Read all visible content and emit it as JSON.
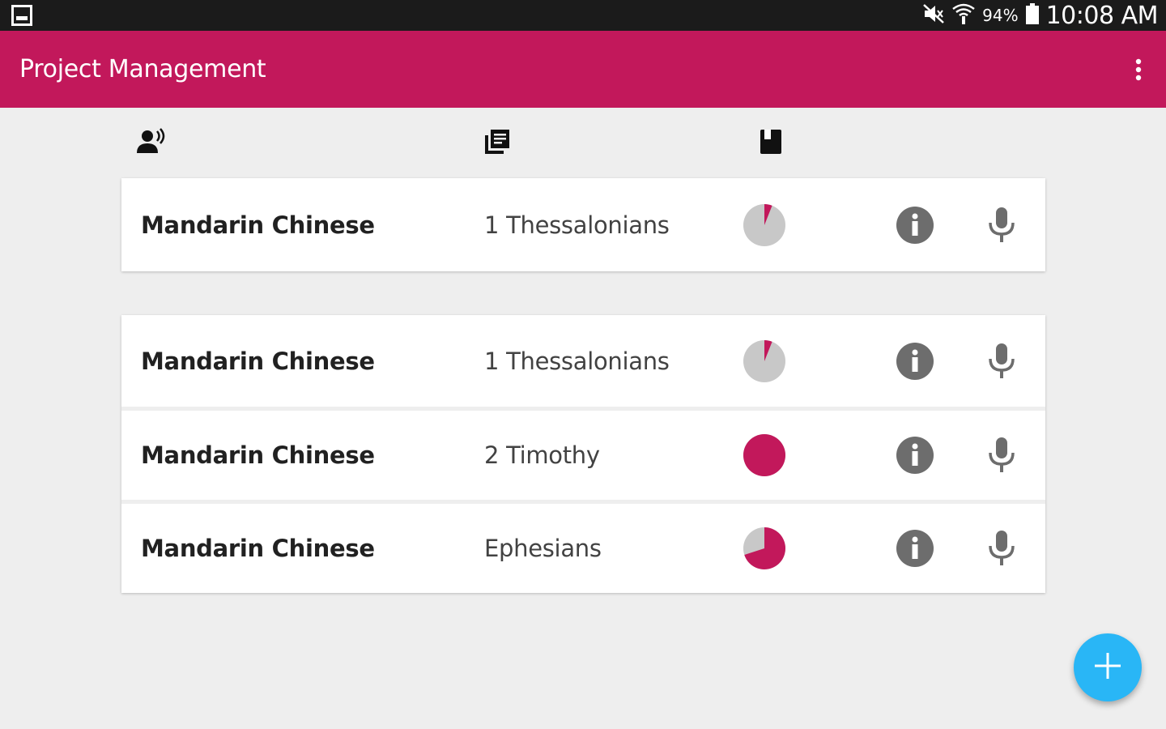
{
  "status_bar": {
    "battery_percent": "94%",
    "time": "10:08 AM",
    "icons": [
      "screenshot-icon",
      "mute-icon",
      "wifi-icon",
      "battery-icon"
    ]
  },
  "app_bar": {
    "title": "Project Management",
    "overflow_icon": "more-vert-icon"
  },
  "column_headers": {
    "icons": [
      "language-speaker-icon",
      "book-pages-icon",
      "book-icon"
    ]
  },
  "colors": {
    "primary": "#c2185b",
    "accent": "#29b6f6",
    "progress_empty": "#c8c8c8",
    "icon_gray": "#6d6d6d"
  },
  "recent_project": {
    "language": "Mandarin Chinese",
    "book": "1 Thessalonians",
    "progress": 0.06
  },
  "projects": [
    {
      "language": "Mandarin Chinese",
      "book": "1 Thessalonians",
      "progress": 0.06
    },
    {
      "language": "Mandarin Chinese",
      "book": "2 Timothy",
      "progress": 1.0
    },
    {
      "language": "Mandarin Chinese",
      "book": "Ephesians",
      "progress": 0.7
    }
  ],
  "fab": {
    "icon": "add-icon"
  }
}
